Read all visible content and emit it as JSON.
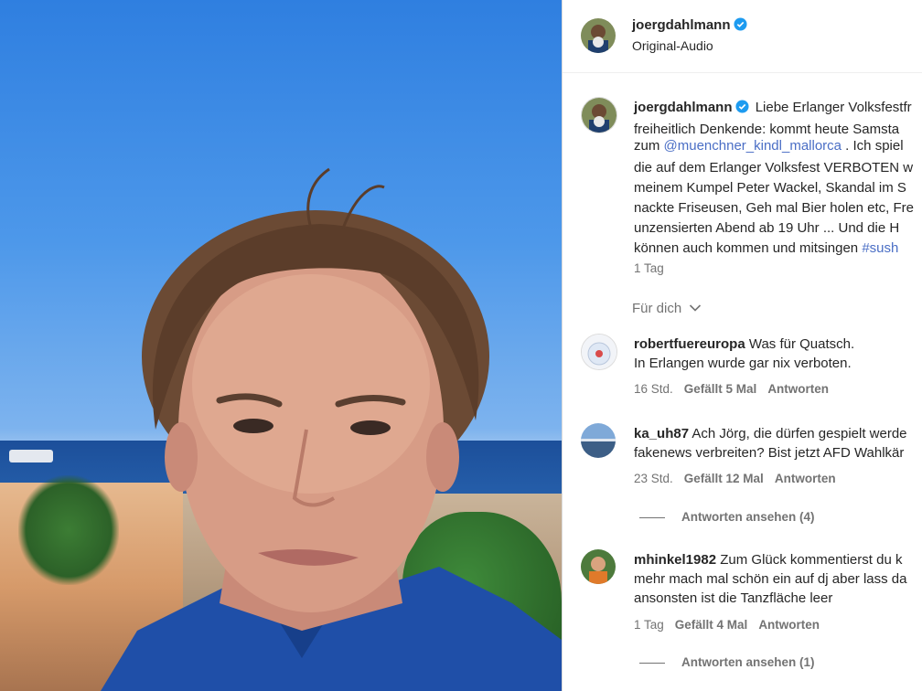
{
  "header": {
    "username": "joergdahlmann",
    "audio": "Original-Audio"
  },
  "caption": {
    "username": "joergdahlmann",
    "lines": [
      "Liebe Erlanger Volksfestfr",
      "freiheitlich Denkende: kommt heute Samsta",
      "zum ",
      "die auf dem Erlanger Volksfest VERBOTEN w",
      "meinem Kumpel Peter Wackel, Skandal im S",
      "nackte Friseusen, Geh mal Bier holen etc, Fre",
      "unzensierten Abend ab 19 Uhr ... Und die H",
      "können auch kommen und mitsingen "
    ],
    "mention": "@muenchner_kindl_mallorca",
    "after_mention": " . Ich spiel",
    "hashtag": "#sush",
    "time": "1 Tag"
  },
  "filter": {
    "label": "Für dich"
  },
  "comments": [
    {
      "username": "robertfuereuropa",
      "text1": "Was für Quatsch.",
      "text2": "In Erlangen wurde gar nix verboten.",
      "text3": "",
      "time": "16 Std.",
      "likes": "Gefällt 5 Mal",
      "reply": "Antworten"
    },
    {
      "username": "ka_uh87",
      "text1": "Ach Jörg, die dürfen gespielt werde",
      "text2": "fakenews verbreiten? Bist jetzt AFD Wahlkär",
      "text3": "",
      "time": "23 Std.",
      "likes": "Gefällt 12 Mal",
      "reply": "Antworten",
      "view_replies": "Antworten ansehen (4)"
    },
    {
      "username": "mhinkel1982",
      "text1": "Zum Glück kommentierst du k",
      "text2": "mehr mach mal schön ein auf dj aber lass da",
      "text3": "ansonsten ist die Tanzfläche leer",
      "time": "1 Tag",
      "likes": "Gefällt 4 Mal",
      "reply": "Antworten",
      "view_replies": "Antworten ansehen (1)"
    }
  ],
  "colors": {
    "link": "#4a6ec5",
    "verified": "#1d9bf0",
    "muted": "#737373"
  }
}
